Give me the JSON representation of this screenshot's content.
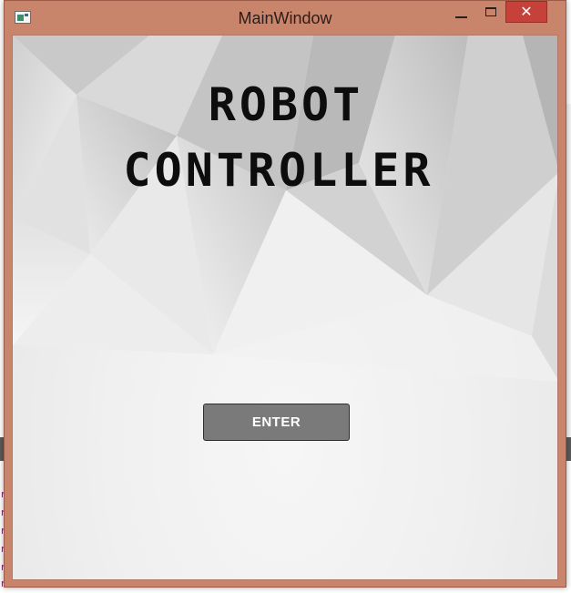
{
  "window": {
    "title": "MainWindow",
    "controls": {
      "minimize_icon": "minimize-icon",
      "maximize_icon": "maximize-icon",
      "close_icon": "close-icon",
      "close_glyph": "✕"
    },
    "frame_color": "#c9846c",
    "close_color": "#c7413b"
  },
  "app": {
    "heading_line_1": "ROBOT",
    "heading_line_2": "CONTROLLER",
    "enter_label": "ENTER"
  },
  "background_editor": {
    "visible_code_chars": [
      "r",
      "r",
      "r",
      "r",
      "r",
      "r"
    ]
  }
}
